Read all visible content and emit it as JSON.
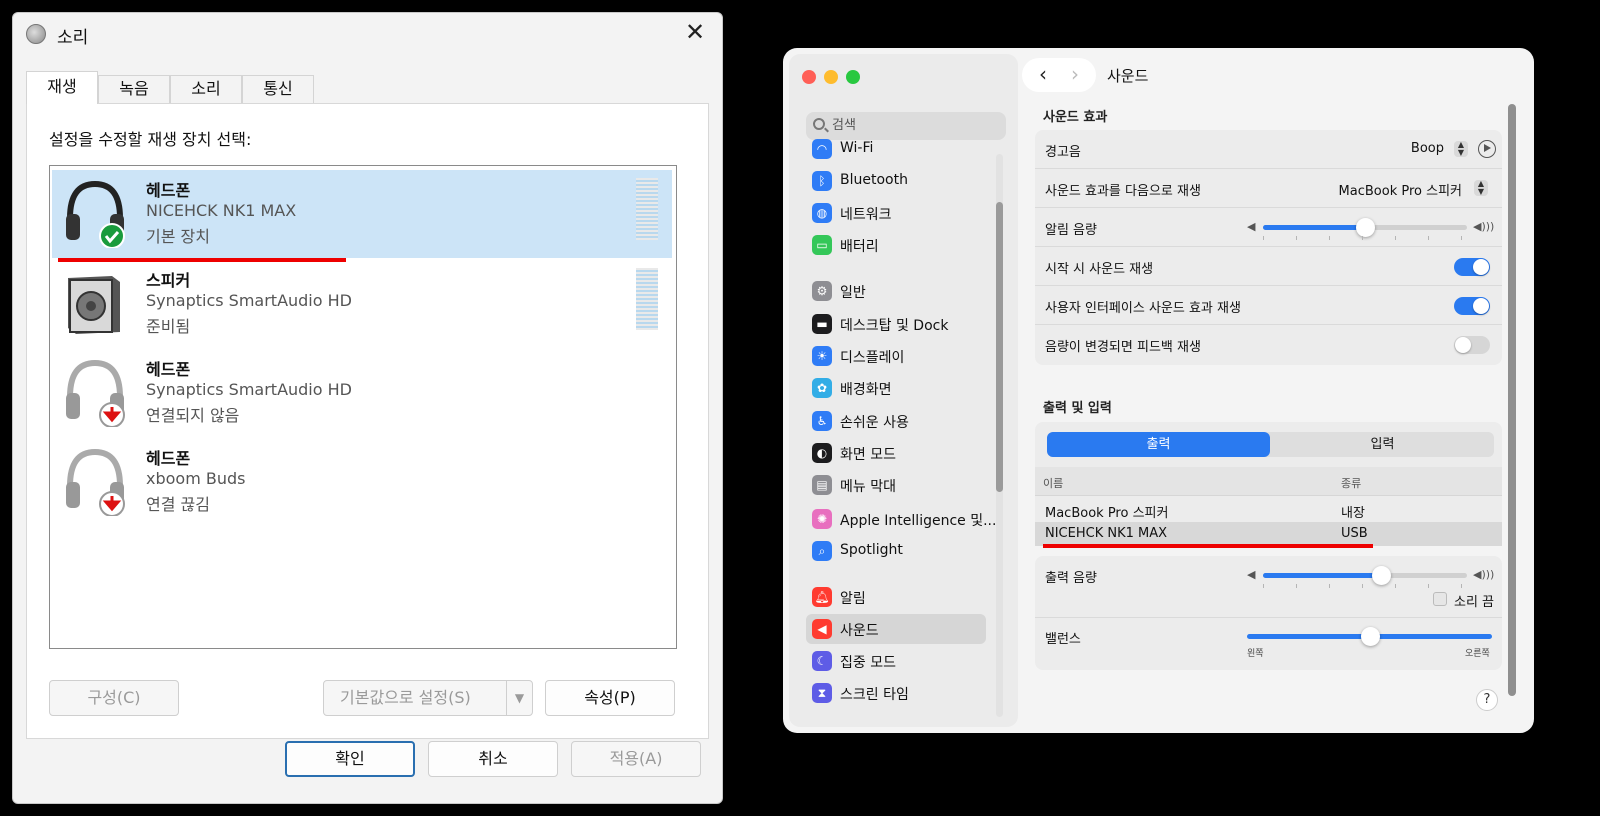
{
  "win": {
    "title": "소리",
    "tabs": [
      "재생",
      "녹음",
      "소리",
      "통신"
    ],
    "panel_label": "설정을 수정할 재생 장치 선택:",
    "devices": [
      {
        "name": "헤드폰",
        "desc": "NICEHCK NK1 MAX",
        "status": "기본 장치",
        "icon": "headphones-default-icon"
      },
      {
        "name": "스피커",
        "desc": "Synaptics SmartAudio HD",
        "status": "준비됨",
        "icon": "speaker-icon"
      },
      {
        "name": "헤드폰",
        "desc": "Synaptics SmartAudio HD",
        "status": "연결되지 않음",
        "icon": "headphones-disconnected-icon"
      },
      {
        "name": "헤드폰",
        "desc": "xboom Buds",
        "status": "연결 끊김",
        "icon": "headphones-disconnected-icon"
      }
    ],
    "buttons": {
      "configure": "구성(C)",
      "set_default": "기본값으로 설정(S)",
      "properties": "속성(P)",
      "ok": "확인",
      "cancel": "취소",
      "apply": "적용(A)"
    }
  },
  "mac": {
    "search_placeholder": "검색",
    "sidebar": [
      {
        "label": "Wi-Fi",
        "icon": "wifi-icon",
        "color": "#2f7cf6"
      },
      {
        "label": "Bluetooth",
        "icon": "bluetooth-icon",
        "color": "#2f7cf6"
      },
      {
        "label": "네트워크",
        "icon": "globe-icon",
        "color": "#2f7cf6"
      },
      {
        "label": "배터리",
        "icon": "battery-icon",
        "color": "#34c759"
      },
      {
        "label": "일반",
        "icon": "gear-icon",
        "color": "#8e8e93"
      },
      {
        "label": "데스크탑 및 Dock",
        "icon": "dock-icon",
        "color": "#1c1c1e"
      },
      {
        "label": "디스플레이",
        "icon": "sun-icon",
        "color": "#2f7cf6"
      },
      {
        "label": "배경화면",
        "icon": "flower-icon",
        "color": "#32ade6"
      },
      {
        "label": "손쉬운 사용",
        "icon": "accessibility-icon",
        "color": "#2f7cf6"
      },
      {
        "label": "화면 모드",
        "icon": "appearance-icon",
        "color": "#1c1c1e"
      },
      {
        "label": "메뉴 막대",
        "icon": "menubar-icon",
        "color": "#8e8e93"
      },
      {
        "label": "Apple Intelligence 및...",
        "icon": "apple-intelligence-icon",
        "color": "#e86fbf"
      },
      {
        "label": "Spotlight",
        "icon": "spotlight-icon",
        "color": "#2f7cf6"
      },
      {
        "label": "알림",
        "icon": "bell-icon",
        "color": "#ff3b30"
      },
      {
        "label": "사운드",
        "icon": "sound-icon",
        "color": "#ff3b30"
      },
      {
        "label": "집중 모드",
        "icon": "moon-icon",
        "color": "#5e5ce6"
      },
      {
        "label": "스크린 타임",
        "icon": "hourglass-icon",
        "color": "#5e5ce6"
      }
    ],
    "active_item": "사운드",
    "title": "사운드",
    "effects": {
      "heading": "사운드 효과",
      "alert_label": "경고음",
      "alert_value": "Boop",
      "play_through_label": "사운드 효과를 다음으로 재생",
      "play_through_value": "MacBook Pro 스피커",
      "alert_volume_label": "알림 음량",
      "alert_volume": 0.5,
      "startup_label": "시작 시 사운드 재생",
      "startup_on": true,
      "ui_sounds_label": "사용자 인터페이스 사운드 효과 재생",
      "ui_sounds_on": true,
      "feedback_label": "음량이 변경되면 피드백 재생",
      "feedback_on": false
    },
    "io": {
      "heading": "출력 및 입력",
      "tab_output": "출력",
      "tab_input": "입력",
      "col_name": "이름",
      "col_type": "종류",
      "devices": [
        {
          "name": "MacBook Pro 스피커",
          "type": "내장"
        },
        {
          "name": "NICEHCK NK1 MAX",
          "type": "USB"
        }
      ],
      "output_volume_label": "출력 음량",
      "output_volume": 0.58,
      "mute_label": "소리 끔",
      "balance_label": "밸런스",
      "balance": 0.5,
      "left_label": "왼쪽",
      "right_label": "오른쪽"
    },
    "help": "?"
  }
}
